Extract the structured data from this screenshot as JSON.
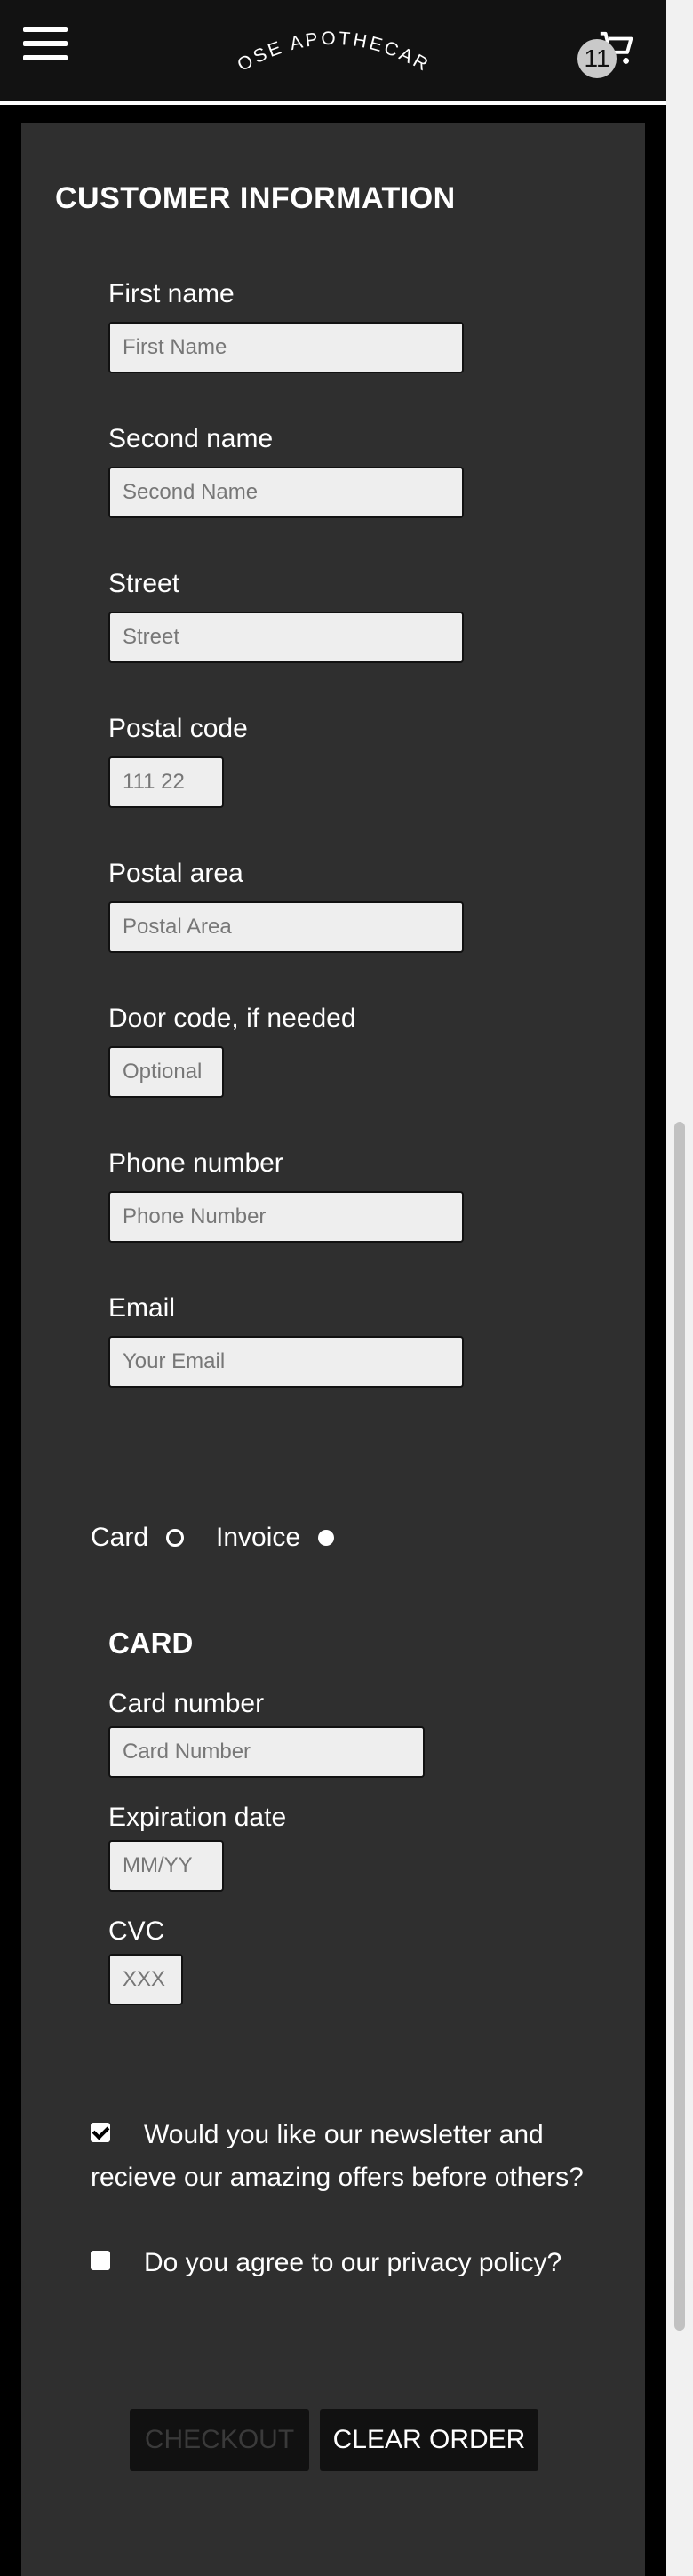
{
  "header": {
    "brand": "ROSE APOTHECARY",
    "cart_count": "11"
  },
  "customer": {
    "title": "CUSTOMER INFORMATION",
    "first_name": {
      "label": "First name",
      "placeholder": "First Name",
      "value": ""
    },
    "second_name": {
      "label": "Second name",
      "placeholder": "Second Name",
      "value": ""
    },
    "street": {
      "label": "Street",
      "placeholder": "Street",
      "value": ""
    },
    "postal_code": {
      "label": "Postal code",
      "placeholder": "111 22",
      "value": ""
    },
    "postal_area": {
      "label": "Postal area",
      "placeholder": "Postal Area",
      "value": ""
    },
    "door_code": {
      "label": "Door code, if needed",
      "placeholder": "Optional",
      "value": ""
    },
    "phone": {
      "label": "Phone number",
      "placeholder": "Phone Number",
      "value": ""
    },
    "email": {
      "label": "Email",
      "placeholder": "Your Email",
      "value": ""
    }
  },
  "payment": {
    "card_label": "Card",
    "invoice_label": "Invoice",
    "selected": "card"
  },
  "card": {
    "title": "CARD",
    "number": {
      "label": "Card number",
      "placeholder": "Card Number",
      "value": ""
    },
    "expiry": {
      "label": "Expiration date",
      "placeholder": "MM/YY",
      "value": ""
    },
    "cvc": {
      "label": "CVC",
      "placeholder": "XXX",
      "value": ""
    }
  },
  "consent": {
    "newsletter_label": "Would you like our newsletter and recieve our amazing offers before others?",
    "newsletter_checked": true,
    "privacy_label": "Do you agree to our privacy policy?",
    "privacy_checked": false
  },
  "actions": {
    "checkout_label": "CHECKOUT",
    "clear_label": "CLEAR ORDER"
  }
}
